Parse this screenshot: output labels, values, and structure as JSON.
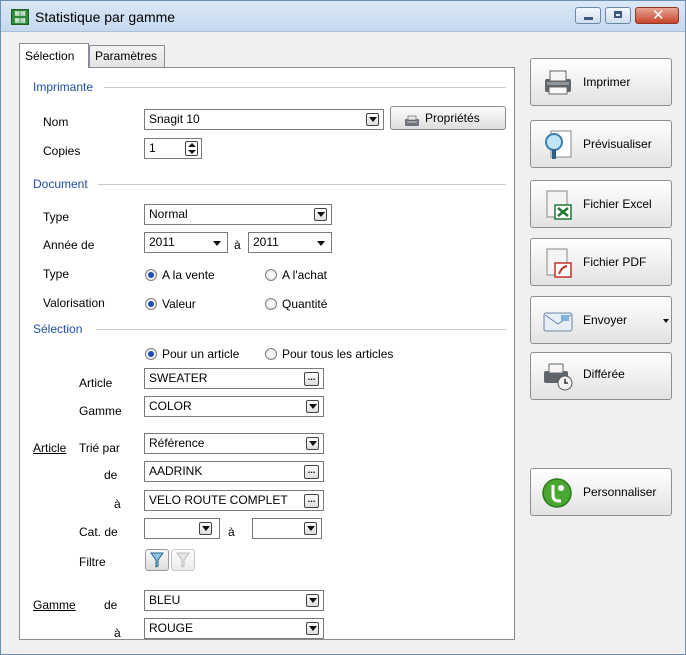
{
  "window": {
    "title": "Statistique par gamme",
    "icon": "app-grid-icon"
  },
  "tabs": [
    {
      "label": "Sélection"
    },
    {
      "label": "Paramètres"
    }
  ],
  "imprimante": {
    "section": "Imprimante",
    "nom_label": "Nom",
    "nom_value": "Snagit 10",
    "proprietes_label": "Propriétés",
    "copies_label": "Copies",
    "copies_value": "1"
  },
  "document": {
    "section": "Document",
    "type_label": "Type",
    "type_value": "Normal",
    "annee_label": "Année de",
    "annee_from": "2011",
    "annee_sep": "à",
    "annee_to": "2011",
    "type2_label": "Type",
    "vente_label": "A la vente",
    "achat_label": "A l'achat",
    "valorisation_label": "Valorisation",
    "valeur_label": "Valeur",
    "quantite_label": "Quantité"
  },
  "selection": {
    "section": "Sélection",
    "un_article_label": "Pour un article",
    "tous_articles_label": "Pour tous les articles",
    "article_label": "Article",
    "article_value": "SWEATER",
    "gamme_label": "Gamme",
    "gamme_value": "COLOR",
    "article_link": "Article",
    "trie_label": "Trié par",
    "trie_value": "Référence",
    "de_label": "de",
    "de_value": "AADRINK",
    "a_label": "à",
    "a_value": "VELO ROUTE COMPLET",
    "cat_label": "Cat. de",
    "cat_sep": "à",
    "filtre_label": "Filtre",
    "gamme_link": "Gamme",
    "gamme_de_label": "de",
    "gamme_de_value": "BLEU",
    "gamme_a_label": "à",
    "gamme_a_value": "ROUGE"
  },
  "actions": [
    {
      "label": "Imprimer",
      "icon": "printer-icon"
    },
    {
      "label": "Prévisualiser",
      "icon": "preview-magnifier-icon"
    },
    {
      "label": "Fichier Excel",
      "icon": "excel-file-icon"
    },
    {
      "label": "Fichier PDF",
      "icon": "pdf-file-icon"
    },
    {
      "label": "Envoyer",
      "icon": "send-mail-icon"
    },
    {
      "label": "Différée",
      "icon": "deferred-print-icon"
    },
    {
      "label": "Personnaliser",
      "icon": "customize-icon"
    }
  ],
  "colors": {
    "section": "#1f4ea3",
    "radio_selected": "#1c4fb6"
  }
}
